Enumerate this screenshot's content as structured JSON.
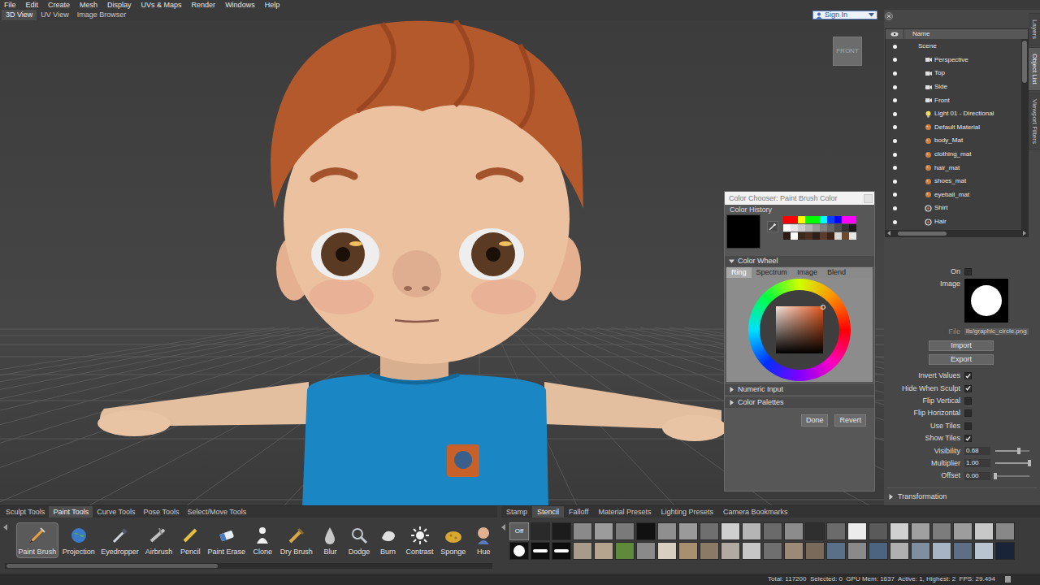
{
  "menu": [
    "File",
    "Edit",
    "Create",
    "Mesh",
    "Display",
    "UVs & Maps",
    "Render",
    "Windows",
    "Help"
  ],
  "view_tabs": [
    {
      "label": "3D View",
      "selected": true
    },
    {
      "label": "UV View",
      "selected": false
    },
    {
      "label": "Image Browser",
      "selected": false
    }
  ],
  "sign_in": "Sign In",
  "view_cube": "FRONT",
  "side_tabs": [
    {
      "label": "Layers",
      "selected": false
    },
    {
      "label": "Object List",
      "selected": true
    },
    {
      "label": "Viewport Filters",
      "selected": false
    }
  ],
  "object_list": {
    "column": "Name",
    "root": {
      "name": "Scene",
      "visible": true
    },
    "items": [
      {
        "name": "Perspective",
        "kind": "camera",
        "visible": true
      },
      {
        "name": "Top",
        "kind": "camera",
        "visible": true
      },
      {
        "name": "Side",
        "kind": "camera",
        "visible": true
      },
      {
        "name": "Front",
        "kind": "camera",
        "visible": true
      },
      {
        "name": "Light 01 - Directional",
        "kind": "light",
        "visible": true
      },
      {
        "name": "Default Material",
        "kind": "material",
        "visible": true
      },
      {
        "name": "body_Mat",
        "kind": "material",
        "visible": true
      },
      {
        "name": "clothing_mat",
        "kind": "material",
        "visible": true
      },
      {
        "name": "hair_mat",
        "kind": "material",
        "visible": true
      },
      {
        "name": "shoes_mat",
        "kind": "material",
        "visible": true
      },
      {
        "name": "eyeball_mat",
        "kind": "material",
        "visible": true
      },
      {
        "name": "Shirt",
        "kind": "mesh",
        "visible": true
      },
      {
        "name": "Hair",
        "kind": "mesh",
        "visible": true
      }
    ]
  },
  "color_chooser": {
    "title": "Color Chooser: Paint Brush Color",
    "history_label": "Color History",
    "current_color": "#000000",
    "history": [
      "#ff0000",
      "#ff0000",
      "#ffff00",
      "#00ff00",
      "#00ff00",
      "#00ffff",
      "#0040ff",
      "#0000ff",
      "#ff00ff",
      "#ff00ff",
      "#ffffff",
      "#e6e6e6",
      "#cccccc",
      "#b3b3b3",
      "#999999",
      "#808080",
      "#666666",
      "#4d4d4d",
      "#333333",
      "#1a1a1a",
      "#2a1c14",
      "#ffffff",
      "#3a2a1e",
      "#4a3020",
      "#2e2018",
      "#5a3a2a",
      "#3a2418",
      "#d8d8d8",
      "#6a4a30",
      "#e6e6e6"
    ],
    "wheel": {
      "label": "Color Wheel",
      "expanded": true,
      "modes": [
        {
          "label": "Ring",
          "selected": true
        },
        {
          "label": "Spectrum",
          "selected": false
        },
        {
          "label": "Image",
          "selected": false
        },
        {
          "label": "Blend",
          "selected": false
        }
      ]
    },
    "sections": [
      {
        "label": "Numeric Input",
        "expanded": false
      },
      {
        "label": "Color Palettes",
        "expanded": false
      }
    ],
    "buttons": [
      "Done",
      "Revert"
    ]
  },
  "stencil_settings": {
    "on": {
      "label": "On",
      "checked": false
    },
    "image_label": "Image",
    "file": {
      "label": "File",
      "value": "ils/graphic_circle.png"
    },
    "buttons": [
      "Import",
      "Export"
    ],
    "options": [
      {
        "label": "Invert Values",
        "checked": true
      },
      {
        "label": "Hide When Sculpt",
        "checked": true
      },
      {
        "label": "Flip Vertical",
        "checked": false
      },
      {
        "label": "Flip Horizontal",
        "checked": false
      },
      {
        "label": "Use Tiles",
        "checked": false
      },
      {
        "label": "Show Tiles",
        "checked": true
      }
    ],
    "sliders": [
      {
        "label": "Visibility",
        "value": "0.68",
        "level": 0.68
      },
      {
        "label": "Multiplier",
        "value": "1.00",
        "level": 1
      },
      {
        "label": "Offset",
        "value": "0.00",
        "level": 0
      }
    ],
    "section": {
      "label": "Transformation",
      "expanded": false
    }
  },
  "tool_tabs": [
    {
      "label": "Sculpt Tools",
      "selected": false
    },
    {
      "label": "Paint Tools",
      "selected": true
    },
    {
      "label": "Curve Tools",
      "selected": false
    },
    {
      "label": "Pose Tools",
      "selected": false
    },
    {
      "label": "Select/Move Tools",
      "selected": false
    }
  ],
  "tools": [
    {
      "label": "Paint Brush",
      "selected": true
    },
    {
      "label": "Projection",
      "selected": false
    },
    {
      "label": "Eyedropper",
      "selected": false
    },
    {
      "label": "Airbrush",
      "selected": false
    },
    {
      "label": "Pencil",
      "selected": false
    },
    {
      "label": "Paint Erase",
      "selected": false
    },
    {
      "label": "Clone",
      "selected": false
    },
    {
      "label": "Dry Brush",
      "selected": false
    },
    {
      "label": "Blur",
      "selected": false
    },
    {
      "label": "Dodge",
      "selected": false
    },
    {
      "label": "Burn",
      "selected": false
    },
    {
      "label": "Contrast",
      "selected": false
    },
    {
      "label": "Sponge",
      "selected": false
    },
    {
      "label": "Hue",
      "selected": false
    }
  ],
  "tray_tabs": [
    {
      "label": "Stamp",
      "selected": false
    },
    {
      "label": "Stencil",
      "selected": true
    },
    {
      "label": "Falloff",
      "selected": false
    },
    {
      "label": "Material Presets",
      "selected": false
    },
    {
      "label": "Lighting Presets",
      "selected": false
    },
    {
      "label": "Camera Bookmarks",
      "selected": false
    }
  ],
  "stencil_off": {
    "label": "Off",
    "selected": true
  },
  "stencils": [
    [
      "#2a2a2a",
      "#1c1c1c",
      "#8a8a8a",
      "#9c9c9c",
      "#7a7a7a",
      "#111111",
      "#8f8f8f",
      "#9a9a9a",
      "#6f6f6f",
      "#cfcfcf",
      "#b5b5b5",
      "#6a6a6a",
      "#8c8c8c",
      "#2f2f2f",
      "#6b6b6b",
      "#ececec",
      "#5a5a5a",
      "#d0d0d0",
      "#a0a0a0",
      "#7c7c7c",
      "#9d9d9d",
      "#c8c8c8",
      "#888888"
    ],
    [
      "#111111",
      "#0d0d0d",
      "#0d0d0d",
      "#a89b8a",
      "#b5a58f",
      "#5f8a3a",
      "#8a8a8a",
      "#d8cfc0",
      "#a88f70",
      "#8a7a66",
      "#b0aaa0",
      "#c6c6c6",
      "#6f6f6f",
      "#9c8a76",
      "#7a6a5a",
      "#5a7088",
      "#8a8a8a",
      "#4d6480",
      "#b0b0b0",
      "#7f8fa0",
      "#a6b4c6",
      "#5d6f85",
      "#b8c4d0",
      "#1a2438"
    ]
  ],
  "status_bar": "Total: 117200  Selected: 0  GPU Mem: 1637  Active: 1, Highest: 2  FPS: 29.494"
}
